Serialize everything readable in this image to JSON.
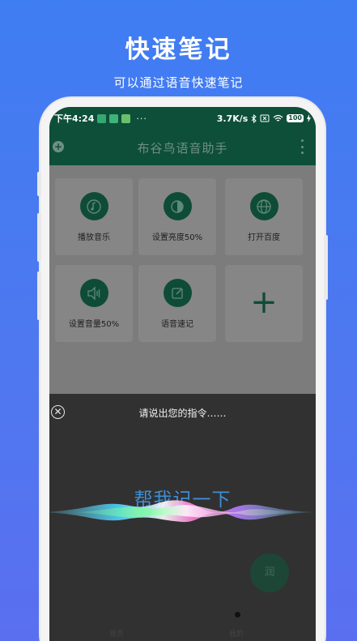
{
  "promo": {
    "title": "快速笔记",
    "subtitle": "可以通过语音快速笔记"
  },
  "status_bar": {
    "time": "下午4:24",
    "dots": "···",
    "network_speed": "3.7K/s",
    "battery": "100"
  },
  "app": {
    "title": "布谷鸟语音助手"
  },
  "tiles": [
    {
      "label": "播放音乐",
      "icon": "music-note-icon"
    },
    {
      "label": "设置亮度50%",
      "icon": "brightness-icon"
    },
    {
      "label": "打开百度",
      "icon": "globe-icon"
    },
    {
      "label": "设置音量50%",
      "icon": "speaker-icon"
    },
    {
      "label": "语音速记",
      "icon": "edit-note-icon"
    },
    {
      "label": "+",
      "icon": "plus-icon"
    }
  ],
  "voice_sheet": {
    "prompt": "请说出您的指令……",
    "result": "帮我记一下",
    "fab_label": "润",
    "tab_left": "首页",
    "tab_right": "我的"
  },
  "colors": {
    "background_blue": "#4a7bf0",
    "app_green": "#0e4f3a",
    "result_blue": "#3d8fd8"
  }
}
